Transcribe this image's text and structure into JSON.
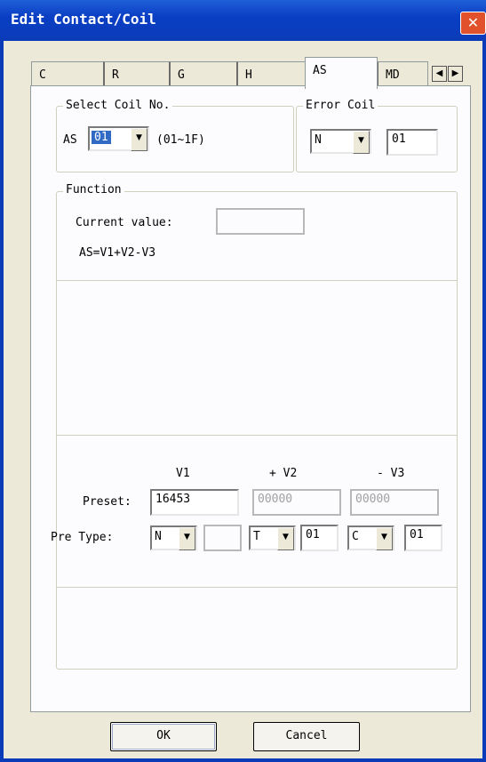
{
  "window": {
    "title": "Edit Contact/Coil",
    "close_glyph": "✕"
  },
  "tabs": [
    {
      "label": "C"
    },
    {
      "label": "R"
    },
    {
      "label": "G"
    },
    {
      "label": "H"
    },
    {
      "label": "AS",
      "active": true
    },
    {
      "label": "MD"
    }
  ],
  "tab_scroll": {
    "left_glyph": "◀",
    "right_glyph": "▶"
  },
  "select_coil": {
    "legend": "Select Coil No.",
    "prefix": "AS",
    "selected": "01",
    "range": "(01~1F)"
  },
  "error_coil": {
    "legend": "Error Coil",
    "type": "N",
    "number": "01"
  },
  "function": {
    "legend": "Function",
    "current_value_label": "Current value:",
    "current_value": "",
    "formula": "AS=V1+V2-V3"
  },
  "params": {
    "headers": {
      "v1": "V1",
      "v2": "+ V2",
      "v3": "- V3"
    },
    "preset_label": "Preset:",
    "preset_v1": "16453",
    "preset_v2": "00000",
    "preset_v3": "00000",
    "pretype_label": "Pre Type:",
    "pretype_v1": "N",
    "pretype_v1_num": "",
    "pretype_v2": "T",
    "pretype_v2_num": "01",
    "pretype_v3": "C",
    "pretype_v3_num": "01"
  },
  "buttons": {
    "ok": "OK",
    "cancel": "Cancel"
  },
  "icons": {
    "dropdown": "▼"
  },
  "colors": {
    "titlebar": "#0b3bb8",
    "close": "#e0512c",
    "selection": "#316ac5",
    "dialog_bg": "#ece9d8"
  }
}
